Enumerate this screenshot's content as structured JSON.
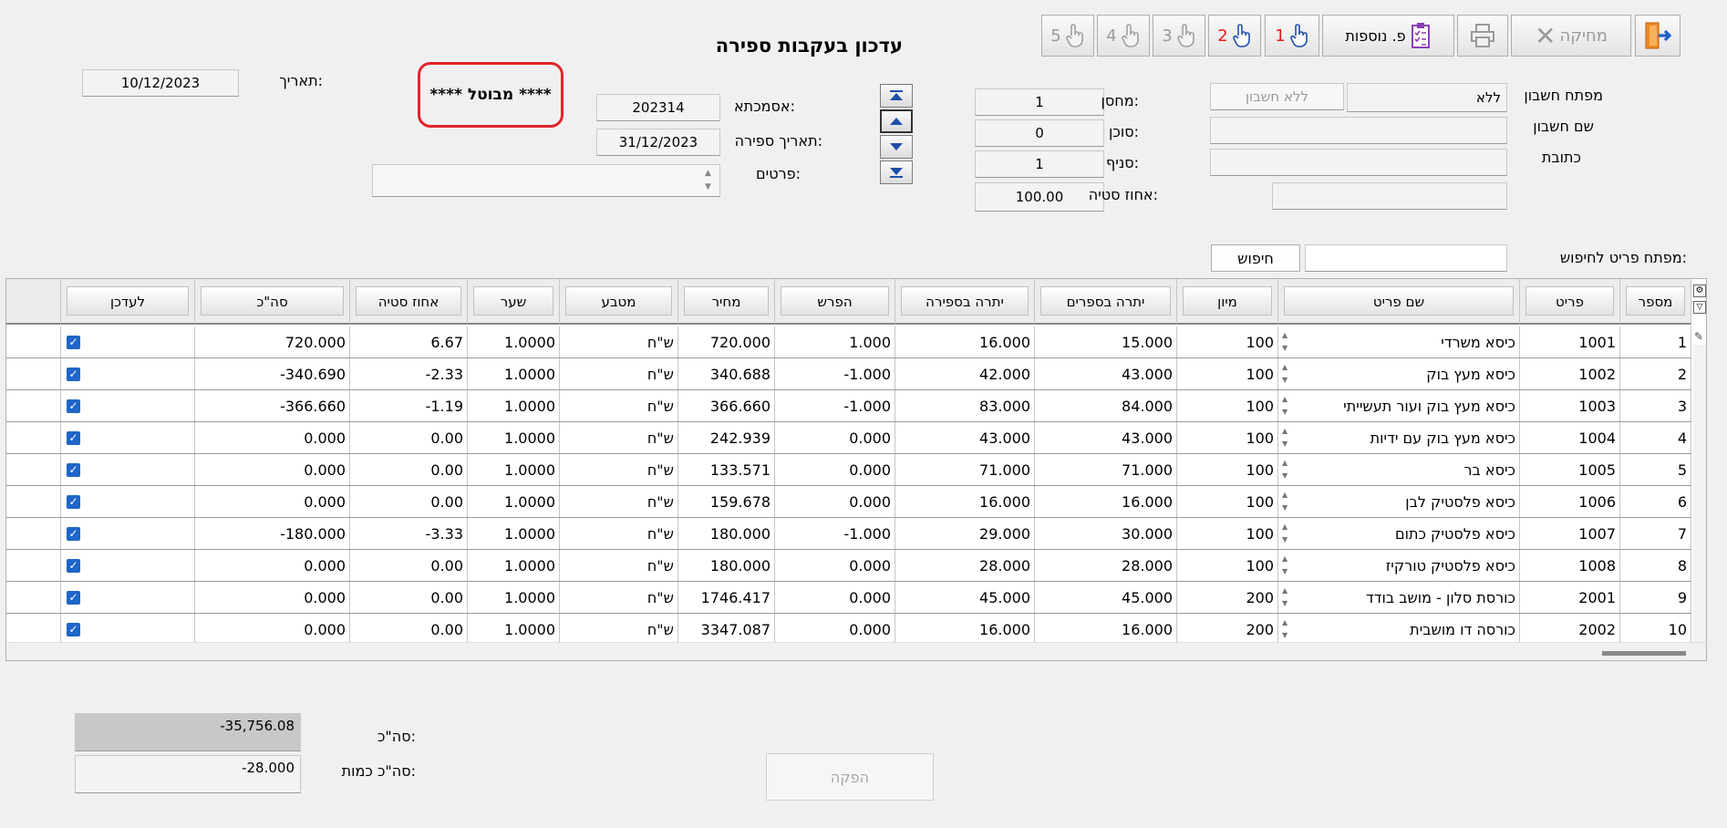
{
  "window": {
    "title": "עדכון בעקבות ספירה"
  },
  "toolbar": {
    "exit_label": "",
    "delete_label": "מחיקה",
    "print_label": "",
    "more_label": "פ. נוספות",
    "hand1": "1",
    "hand2": "2",
    "hand3": "3",
    "hand4": "4",
    "hand5": "5"
  },
  "header": {
    "date_label": "תאריך:",
    "date_value": "10/12/2023",
    "status_stamp": "**** מבוטל ****",
    "reference_label": "אסמכתא:",
    "reference_value": "202314",
    "count_date_label": "תאריך ספירה:",
    "count_date_value": "31/12/2023",
    "details_label": "פרטים:",
    "details_value": "",
    "warehouse_label": "מחסן:",
    "warehouse_value": "1",
    "agent_label": "סוכן:",
    "agent_value": "0",
    "branch_label": "סניף:",
    "branch_value": "1",
    "deviation_label": "אחוז סטיה:",
    "deviation_value": "100.00",
    "account_key_label": "מפתח חשבון",
    "account_key_value": "ללא",
    "account_key_hint": "ללא חשבון",
    "account_name_label": "שם חשבון",
    "account_name_value": "",
    "address_label": "כתובת",
    "address_value": "",
    "address2_value": ""
  },
  "search": {
    "label": "מפתח פריט לחיפוש:",
    "value": "",
    "button_label": "חיפוש"
  },
  "table": {
    "columns": [
      "מספר",
      "פריט",
      "שם פריט",
      "מיון",
      "יתרה בספרים",
      "יתרה בספירה",
      "הפרש",
      "מחיר",
      "מטבע",
      "שער",
      "אחוז סטיה",
      "סה\"כ",
      "לעדכן"
    ],
    "rows": [
      [
        "1",
        "1001",
        "כיסא משרדי",
        "100",
        "15.000",
        "16.000",
        "1.000",
        "720.000",
        "ש\"ח",
        "1.0000",
        "6.67",
        "720.000"
      ],
      [
        "2",
        "1002",
        "כיסא מעץ בוק",
        "100",
        "43.000",
        "42.000",
        "-1.000",
        "340.688",
        "ש\"ח",
        "1.0000",
        "-2.33",
        "-340.690"
      ],
      [
        "3",
        "1003",
        "כיסא מעץ בוק ועור תעשייתי",
        "100",
        "84.000",
        "83.000",
        "-1.000",
        "366.660",
        "ש\"ח",
        "1.0000",
        "-1.19",
        "-366.660"
      ],
      [
        "4",
        "1004",
        "כיסא מעץ בוק עם ידיות",
        "100",
        "43.000",
        "43.000",
        "0.000",
        "242.939",
        "ש\"ח",
        "1.0000",
        "0.00",
        "0.000"
      ],
      [
        "5",
        "1005",
        "כיסא בר",
        "100",
        "71.000",
        "71.000",
        "0.000",
        "133.571",
        "ש\"ח",
        "1.0000",
        "0.00",
        "0.000"
      ],
      [
        "6",
        "1006",
        "כיסא פלסטיק לבן",
        "100",
        "16.000",
        "16.000",
        "0.000",
        "159.678",
        "ש\"ח",
        "1.0000",
        "0.00",
        "0.000"
      ],
      [
        "7",
        "1007",
        "כיסא פלסטיק כתום",
        "100",
        "30.000",
        "29.000",
        "-1.000",
        "180.000",
        "ש\"ח",
        "1.0000",
        "-3.33",
        "-180.000"
      ],
      [
        "8",
        "1008",
        "כיסא פלסטיק טורקיז",
        "100",
        "28.000",
        "28.000",
        "0.000",
        "180.000",
        "ש\"ח",
        "1.0000",
        "0.00",
        "0.000"
      ],
      [
        "9",
        "2001",
        "כורסת סלון - מושב בודד",
        "200",
        "45.000",
        "45.000",
        "0.000",
        "1746.417",
        "ש\"ח",
        "1.0000",
        "0.00",
        "0.000"
      ],
      [
        "10",
        "2002",
        "כורסה דו מושבית",
        "200",
        "16.000",
        "16.000",
        "0.000",
        "3347.087",
        "ש\"ח",
        "1.0000",
        "0.00",
        "0.000"
      ]
    ],
    "checked": [
      true,
      true,
      true,
      true,
      true,
      true,
      true,
      true,
      true,
      true
    ]
  },
  "footer": {
    "total_label": "סה\"כ:",
    "total_value": "-35,756.08",
    "total_qty_label": "סה\"כ כמות:",
    "total_qty_value": "-28.000",
    "produce_button": "הפקה"
  },
  "colors": {
    "stamp_border": "#e2242a",
    "check": "#1e66c8",
    "hand_red": "#e11b1b"
  }
}
